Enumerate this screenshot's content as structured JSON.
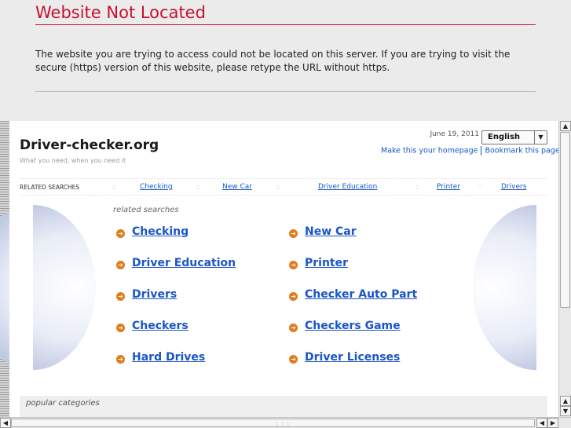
{
  "error": {
    "title": "Website Not Located",
    "message": "The website you are trying to access could not be located on this server. If you are trying to visit the secure (https) version of this website, please retype the URL without https."
  },
  "site": {
    "title": "Driver-checker.org",
    "tagline": "What you need, when you need it",
    "date": "June 19, 2011",
    "language": "English",
    "make_homepage": "Make this your homepage",
    "bookmark": "Bookmark this page"
  },
  "related_bar": {
    "label": "RELATED SEARCHES",
    "separator": "::",
    "links": [
      "Checking",
      "New Car",
      "Driver Education",
      "Printer",
      "Drivers"
    ]
  },
  "related": {
    "heading": "related searches",
    "results": [
      "Checking",
      "New Car",
      "Driver Education",
      "Printer",
      "Drivers",
      "Checker Auto Part",
      "Checkers",
      "Checkers Game",
      "Hard Drives",
      "Driver Licenses"
    ]
  },
  "popular": {
    "heading": "popular categories"
  },
  "icons": {
    "result_bullet": "arrow-circle-icon",
    "dropdown": "chevron-down-icon",
    "scroll_up": "arrow-up-icon",
    "scroll_down": "arrow-down-icon",
    "scroll_left": "arrow-left-icon",
    "scroll_right": "arrow-right-icon"
  },
  "colors": {
    "error_red": "#c8102e",
    "link_blue": "#1a55c8",
    "bullet_orange": "#e27a1a"
  }
}
